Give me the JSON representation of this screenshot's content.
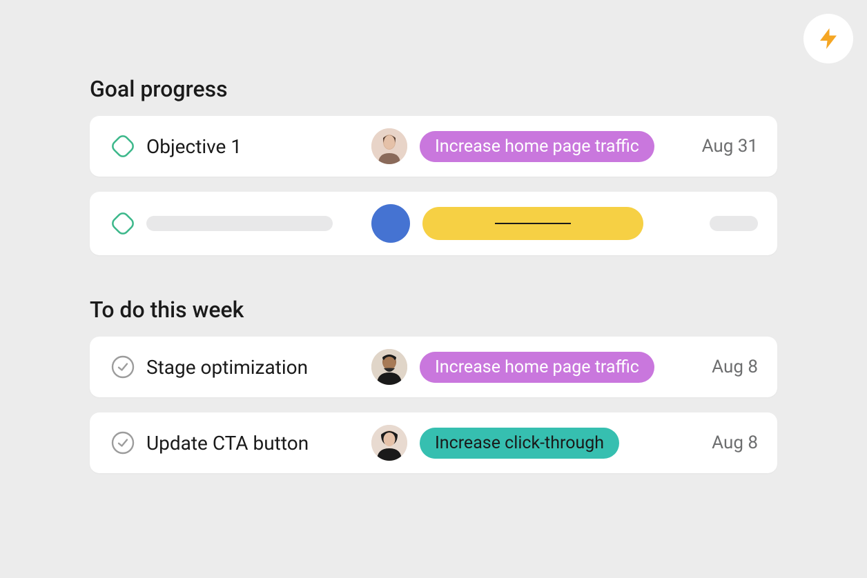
{
  "colors": {
    "tag_purple": "#c977dd",
    "tag_teal": "#36bfb0",
    "tag_yellow": "#f6d044",
    "avatar_blue": "#4573d2"
  },
  "goal_progress": {
    "title": "Goal progress",
    "items": [
      {
        "title": "Objective 1",
        "tag": "Increase home page traffic",
        "tag_color": "purple",
        "date": "Aug 31",
        "has_avatar": true
      },
      {
        "skeleton": true
      }
    ]
  },
  "todo": {
    "title": "To do this week",
    "items": [
      {
        "title": "Stage optimization",
        "tag": "Increase home page traffic",
        "tag_color": "purple",
        "date": "Aug 8",
        "has_avatar": true
      },
      {
        "title": "Update CTA button",
        "tag": "Increase click-through",
        "tag_color": "teal",
        "date": "Aug 8",
        "has_avatar": true
      }
    ]
  }
}
